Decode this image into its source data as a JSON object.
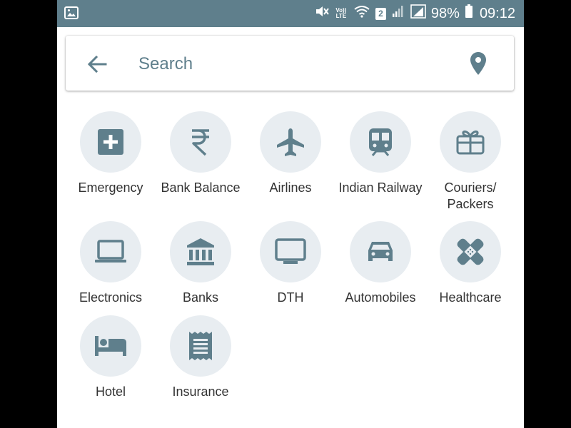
{
  "status_bar": {
    "battery_percent": "98%",
    "time": "09:12",
    "volte_label": "Vo)) LTE",
    "sim_slot": "2",
    "icons": [
      "image-icon",
      "mute-icon",
      "volte-icon",
      "wifi-icon",
      "signal-icon",
      "battery-icon"
    ]
  },
  "search": {
    "placeholder": "Search",
    "value": "",
    "back_icon": "arrow-left-icon",
    "location_icon": "map-pin-icon"
  },
  "categories": [
    {
      "label": "Emergency",
      "icon": "medical-plus-icon"
    },
    {
      "label": "Bank Balance",
      "icon": "rupee-icon"
    },
    {
      "label": "Airlines",
      "icon": "airplane-icon"
    },
    {
      "label": "Indian Railway",
      "icon": "train-icon"
    },
    {
      "label": "Couriers/\nPackers",
      "icon": "gift-icon"
    },
    {
      "label": "Electronics",
      "icon": "laptop-icon"
    },
    {
      "label": "Banks",
      "icon": "bank-icon"
    },
    {
      "label": "DTH",
      "icon": "tv-icon"
    },
    {
      "label": "Automobiles",
      "icon": "car-icon"
    },
    {
      "label": "Healthcare",
      "icon": "bandage-icon"
    },
    {
      "label": "Hotel",
      "icon": "bed-icon"
    },
    {
      "label": "Insurance",
      "icon": "receipt-icon"
    }
  ],
  "colors": {
    "status_bar": "#5f7f8c",
    "icon": "#5f7f8c",
    "icon_circle": "#e8edf1",
    "label_text": "#333333"
  }
}
